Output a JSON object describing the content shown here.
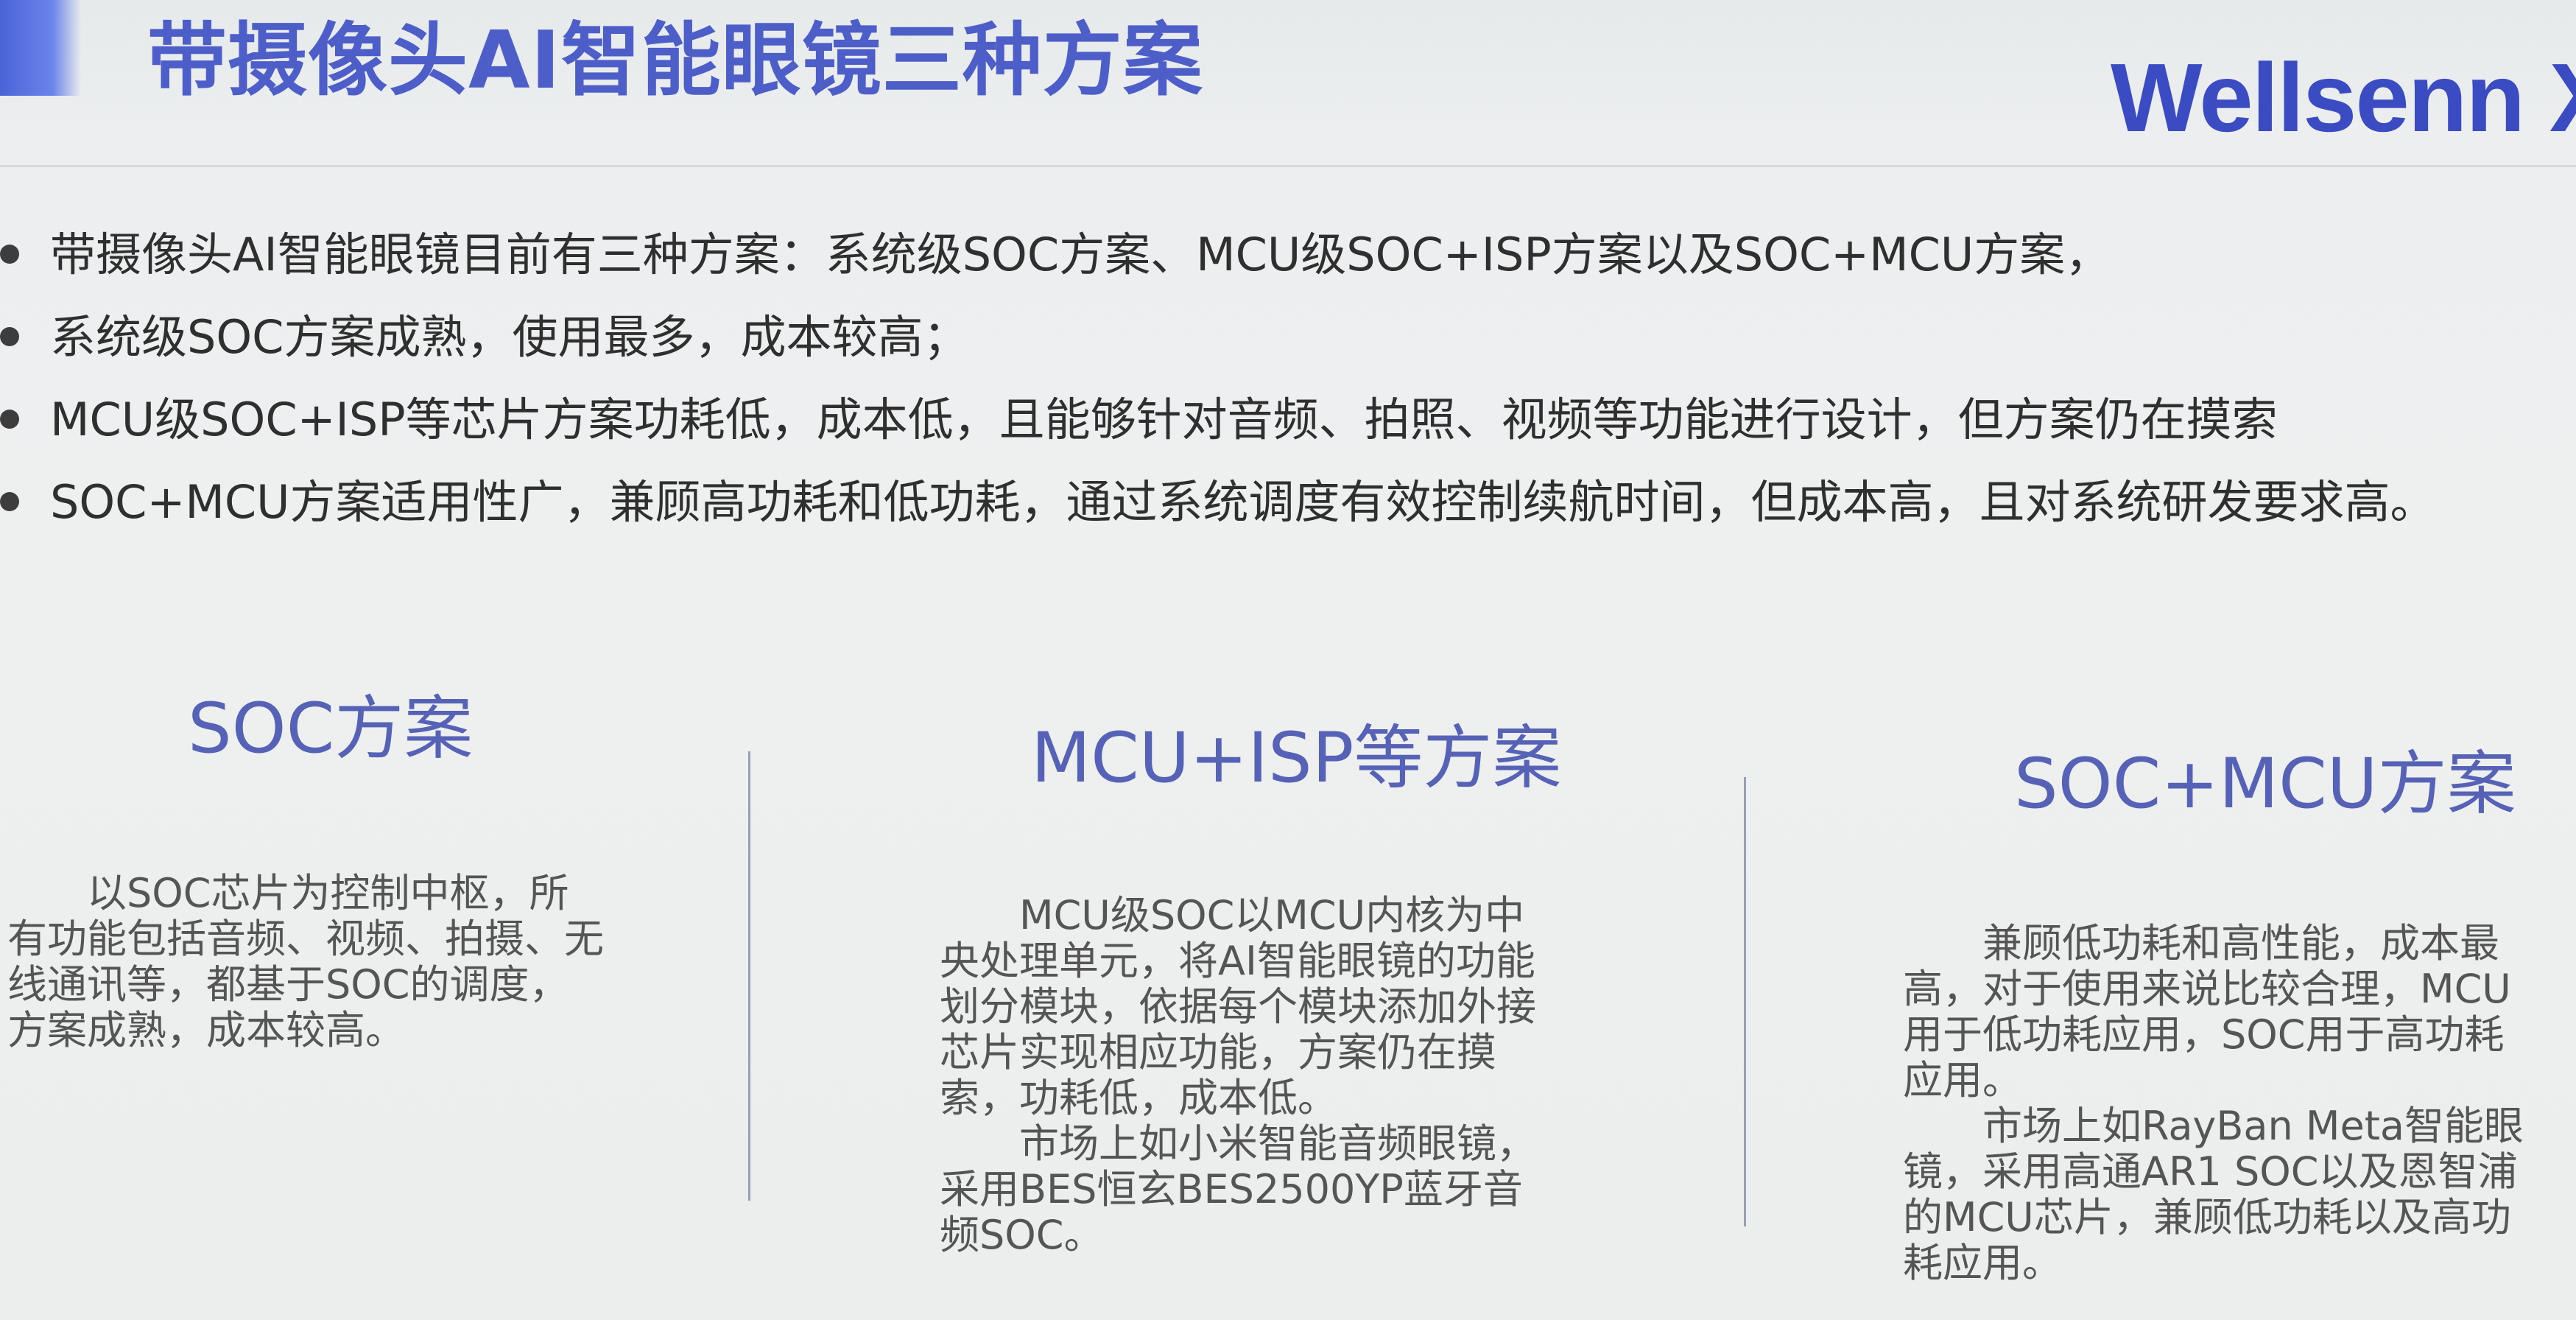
{
  "header": {
    "title": "带摄像头AI智能眼镜三种方案",
    "logo_text": "Wellsenn X"
  },
  "bullets": [
    "带摄像头AI智能眼镜目前有三种方案：系统级SOC方案、MCU级SOC+ISP方案以及SOC+MCU方案，",
    "系统级SOC方案成熟，使用最多，成本较高；",
    "MCU级SOC+ISP等芯片方案功耗低，成本低，且能够针对音频、拍照、视频等功能进行设计，但方案仍在摸索",
    "SOC+MCU方案适用性广，兼顾高功耗和低功耗，通过系统调度有效控制续航时间，但成本高，且对系统研发要求高。"
  ],
  "columns": [
    {
      "heading": "SOC方案",
      "paragraphs": [
        "以SOC芯片为控制中枢，所有功能包括音频、视频、拍摄、无线通讯等，都基于SOC的调度，方案成熟，成本较高。"
      ]
    },
    {
      "heading": "MCU+ISP等方案",
      "paragraphs": [
        "MCU级SOC以MCU内核为中央处理单元，将AI智能眼镜的功能划分模块，依据每个模块添加外接芯片实现相应功能，方案仍在摸索，功耗低，成本低。",
        "市场上如小米智能音频眼镜，采用BES恒玄BES2500YP蓝牙音频SOC。"
      ]
    },
    {
      "heading": "SOC+MCU方案",
      "paragraphs": [
        "兼顾低功耗和高性能，成本最高，对于使用来说比较合理，MCU用于低功耗应用，SOC用于高功耗应用。",
        "市场上如RayBan Meta智能眼镜，采用高通AR1 SOC以及恩智浦的MCU芯片，兼顾低功耗以及高功耗应用。"
      ]
    }
  ]
}
